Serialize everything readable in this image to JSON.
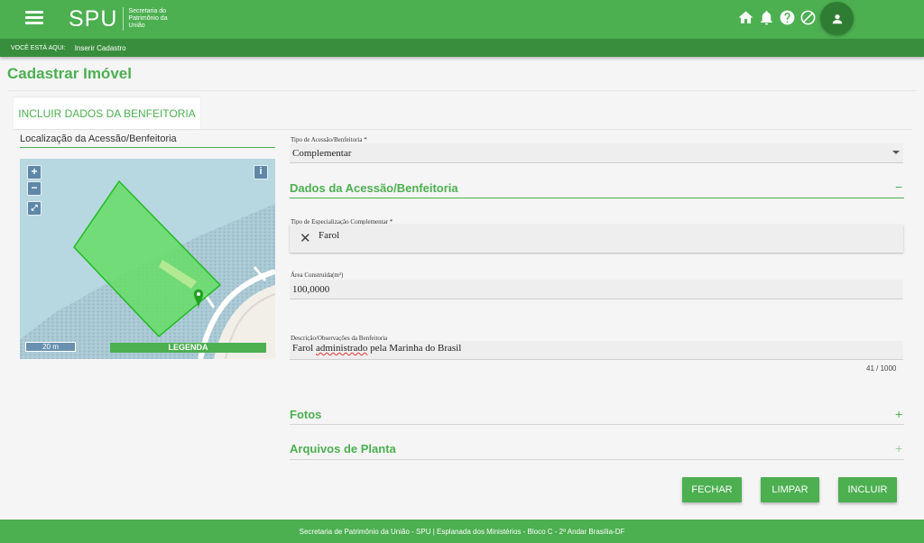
{
  "header": {
    "logo": "SPU",
    "logo_subtitle": "Secretaria do Patrimônio da União",
    "icons": [
      "home-icon",
      "bell-icon",
      "help-icon",
      "block-icon"
    ],
    "avatar_icon": "user-icon"
  },
  "breadcrumb": {
    "label": "VOCÊ ESTÁ AQUI:",
    "current": "Inserir Cadastro"
  },
  "page_title": "Cadastrar Imóvel",
  "tab": {
    "label": "INCLUIR DADOS DA BENFEITORIA"
  },
  "map": {
    "title": "Localização da Acessão/Benfeitoria",
    "zoom_in": "+",
    "zoom_out": "−",
    "info": "i",
    "scale": "20 m",
    "legend": "LEGENDA",
    "polygon_color": "#66dd66",
    "marker_color": "#22a022"
  },
  "form": {
    "tipo": {
      "label": "Tipo de Acessão/Benfeitoria *",
      "value": "Complementar"
    },
    "section_dados": {
      "title": "Dados da Acessão/Benfeitoria",
      "toggle": "−"
    },
    "especializacao": {
      "label": "Tipo de Especialização Complementar *",
      "value": "Farol"
    },
    "area": {
      "label": "Área Construída(m²)",
      "value": "100,0000"
    },
    "descricao": {
      "label": "Descrição/Observações da Benfeitoria",
      "value_part1": "Farol ",
      "value_part2": "administrado",
      "value_part3": " pela Marinha do Brasil",
      "counter": "41 / 1000"
    },
    "section_fotos": {
      "title": "Fotos",
      "toggle": "+"
    },
    "section_arquivos": {
      "title": "Arquivos de Planta",
      "toggle": "+"
    }
  },
  "buttons": {
    "fechar": "FECHAR",
    "limpar": "LIMPAR",
    "incluir": "INCLUIR"
  },
  "footer": "Secretaria de Patrimônio da União - SPU | Esplanada dos Ministérios - Bloco C - 2º Andar Brasília-DF",
  "colors": {
    "primary": "#4caf50",
    "dark": "#388e3c",
    "avatar": "#2e7d32"
  }
}
